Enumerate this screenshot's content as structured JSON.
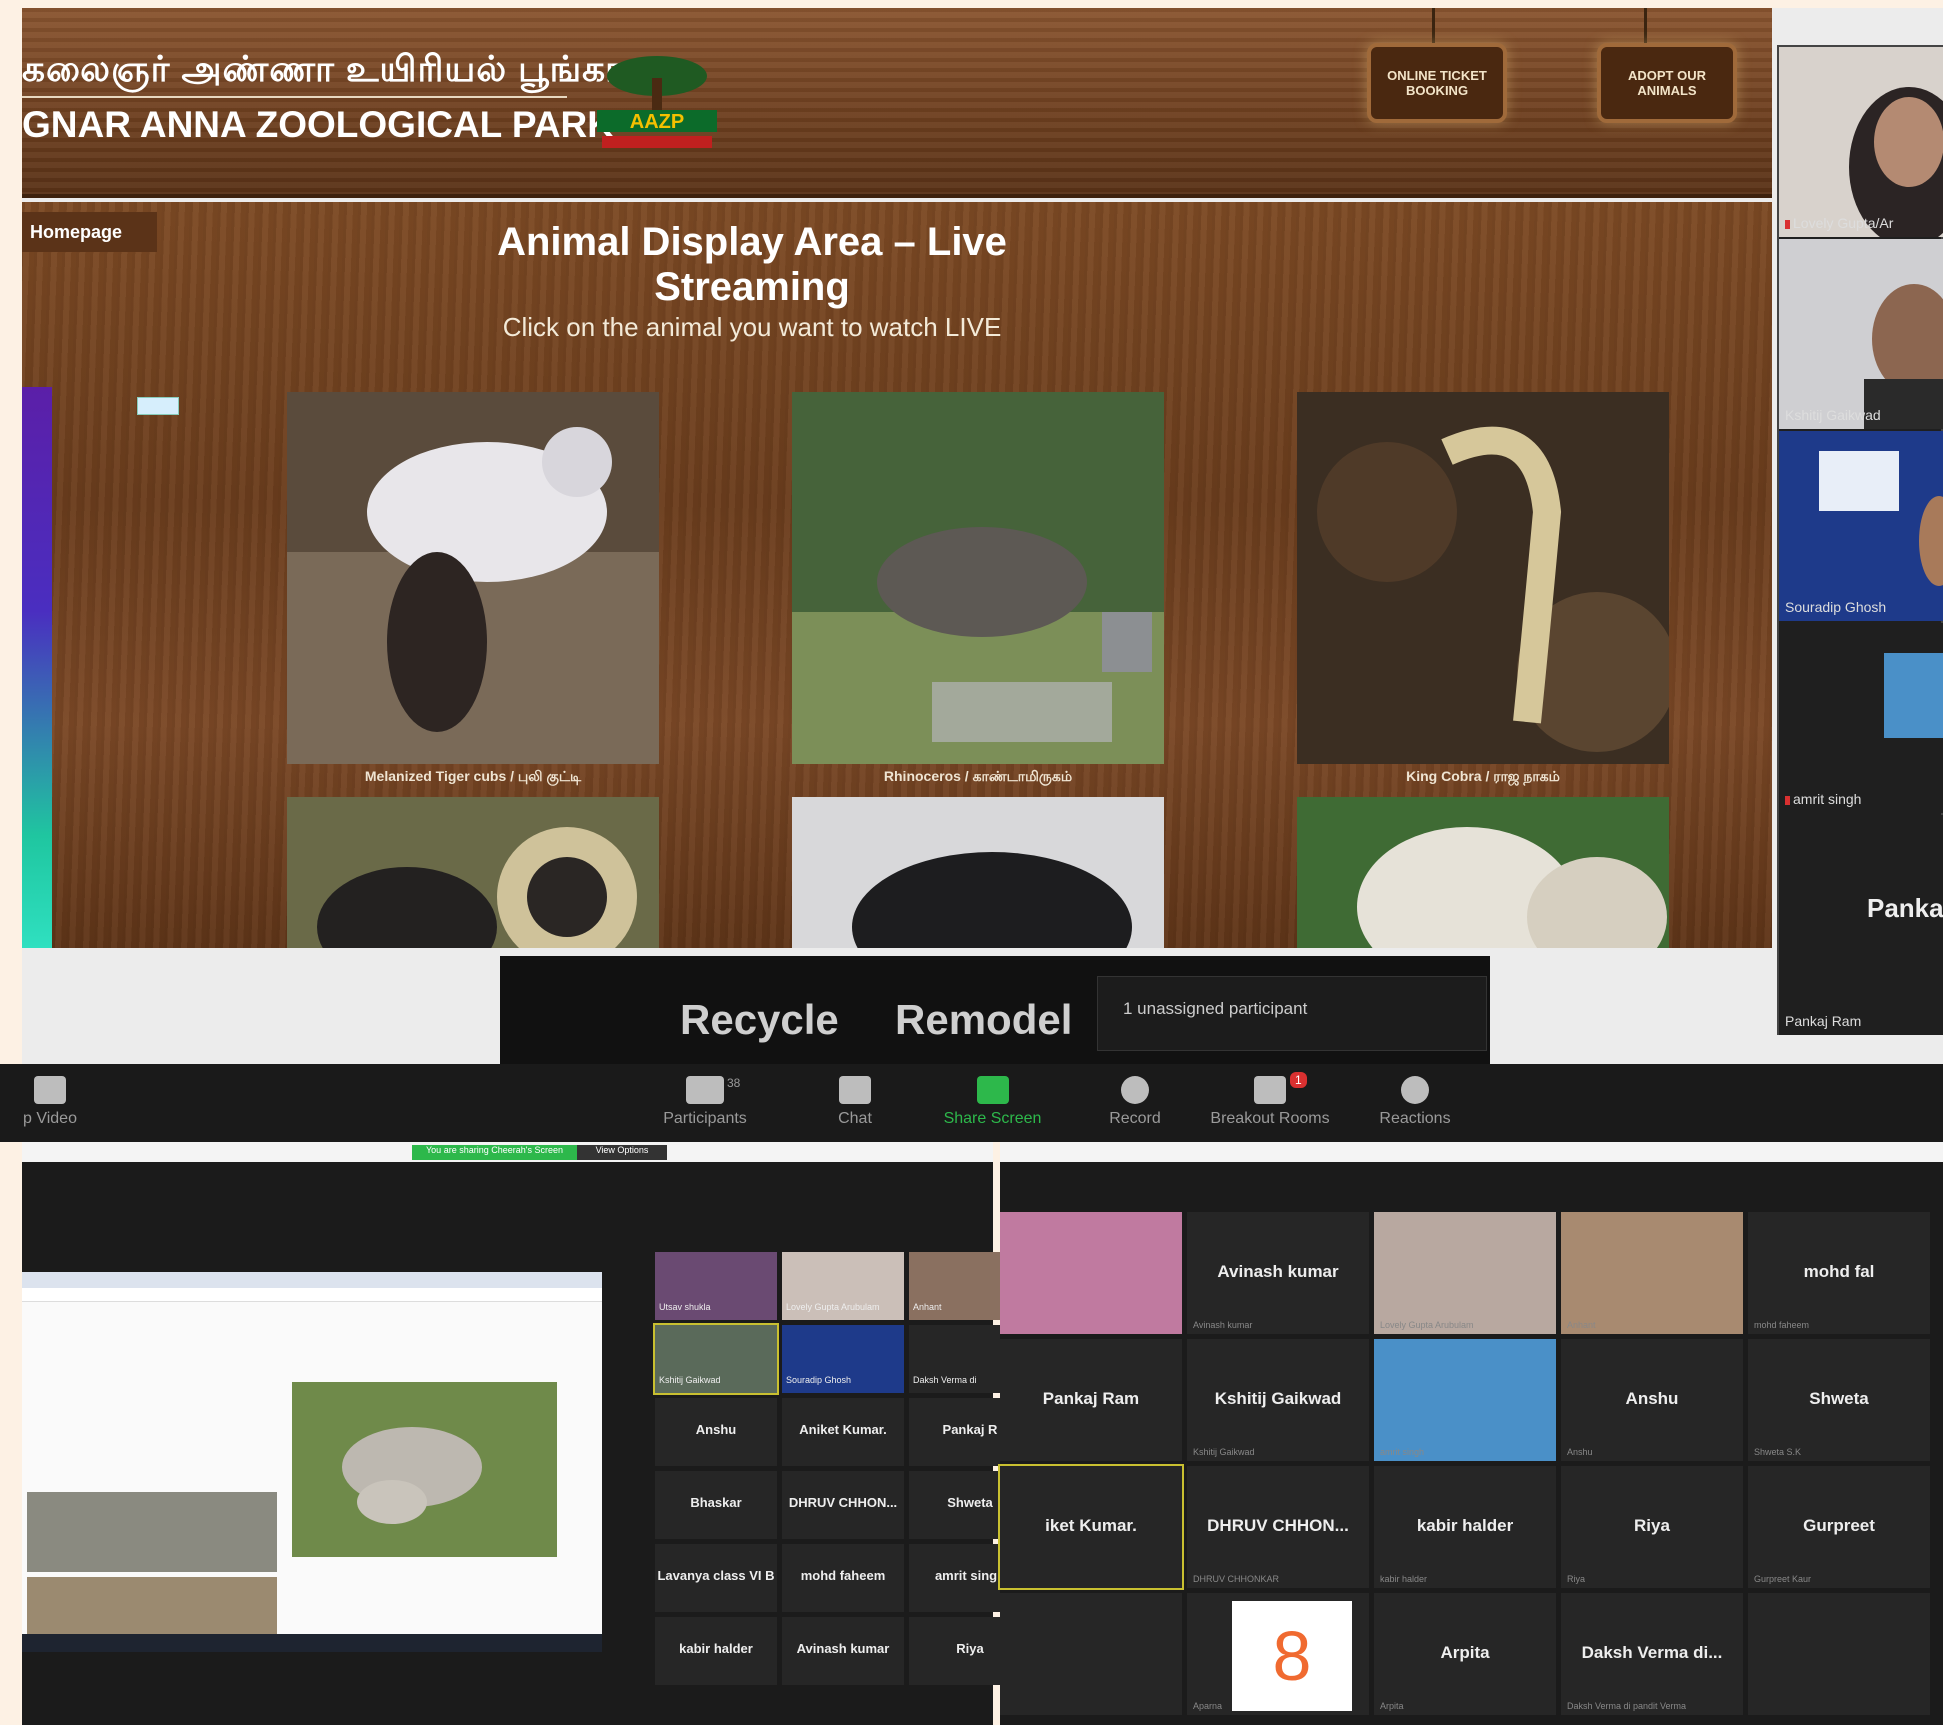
{
  "zoo": {
    "tamil_title": "கலைஞர் அண்ணா உயிரியல் பூங்கா",
    "park_name": "GNAR ANNA ZOOLOGICAL PARK",
    "logo_text": "AAZP",
    "online_ticket": "ONLINE TICKET BOOKING",
    "adopt": "ADOPT OUR ANIMALS",
    "homepage": "Homepage",
    "heading": "Animal Display Area – Live Streaming",
    "subheading": "Click on the animal you want to watch LIVE",
    "animals": [
      {
        "caption": "Melanized Tiger cubs / புலி குட்டி"
      },
      {
        "caption": "Rhinoceros / காண்டாமிருகம்"
      },
      {
        "caption": "King Cobra / ராஜ நாகம்"
      }
    ]
  },
  "sidebar": {
    "participants": [
      "Lovely Gupta/Ar",
      "Kshitij Gaikwad",
      "Souradip Ghosh",
      "amrit singh",
      "Pankaj Ram"
    ],
    "big_name": "Panka"
  },
  "share": {
    "text_a": "Recycle",
    "text_b": "Remodel",
    "popup": "1 unassigned participant"
  },
  "toolbar": {
    "video": "p Video",
    "participants": "Participants",
    "chat": "Chat",
    "share": "Share Screen",
    "record": "Record",
    "breakout": "Breakout Rooms",
    "reactions": "Reactions",
    "participants_count": "38",
    "breakout_badge": "1"
  },
  "left_panel": {
    "sharing_banner": "You are sharing Cheerah's Screen",
    "view_options": "View Options",
    "tiles": [
      {
        "name": "Utsav shukla"
      },
      {
        "name": "Lovely Gupta Arubulam"
      },
      {
        "name": "Anhant"
      },
      {
        "name": "Kshitij Gaikwad"
      },
      {
        "name": "Souradip Ghosh"
      },
      {
        "name": "Daksh Verma di"
      },
      {
        "name": "Anshu"
      },
      {
        "name": "Aniket Kumar."
      },
      {
        "name": "Pankaj R"
      },
      {
        "name": "Bhaskar"
      },
      {
        "name": "DHRUV CHHON..."
      },
      {
        "name": "Shweta"
      },
      {
        "name": "Lavanya class VI B"
      },
      {
        "name": "mohd faheem"
      },
      {
        "name": "amrit singh"
      },
      {
        "name": "kabir halder"
      },
      {
        "name": "Avinash kumar"
      },
      {
        "name": "Riya"
      }
    ]
  },
  "right_panel": {
    "tiles": [
      {
        "name": ""
      },
      {
        "name": "Avinash kumar",
        "sub": "Avinash kumar"
      },
      {
        "name": "",
        "sub": "Lovely Gupta Arubulam"
      },
      {
        "name": "",
        "sub": "Anhant"
      },
      {
        "name": "mohd fal",
        "sub": "mohd faheem"
      },
      {
        "name": "Pankaj Ram"
      },
      {
        "name": "Kshitij Gaikwad",
        "sub": "Kshitij Gaikwad"
      },
      {
        "name": "",
        "sub": "amrit singh"
      },
      {
        "name": "Anshu",
        "sub": "Anshu"
      },
      {
        "name": "Shweta",
        "sub": "Shweta S.K"
      },
      {
        "name": "iket Kumar."
      },
      {
        "name": "DHRUV CHHON...",
        "sub": "DHRUV CHHONKAR"
      },
      {
        "name": "kabir halder",
        "sub": "kabir halder"
      },
      {
        "name": "Riya",
        "sub": "Riya"
      },
      {
        "name": "Gurpreet",
        "sub": "Gurpreet Kaur"
      },
      {
        "name": ""
      },
      {
        "name": "",
        "sub": "Aparna"
      },
      {
        "name": "Arpita",
        "sub": "Arpita"
      },
      {
        "name": "Daksh Verma di...",
        "sub": "Daksh Verma di pandit Verma"
      },
      {
        "name": ""
      }
    ]
  },
  "colors": {
    "zoom_green": "#2db84b",
    "wood": "#6b3d1d",
    "zoom_bg": "#1b1b1b"
  }
}
